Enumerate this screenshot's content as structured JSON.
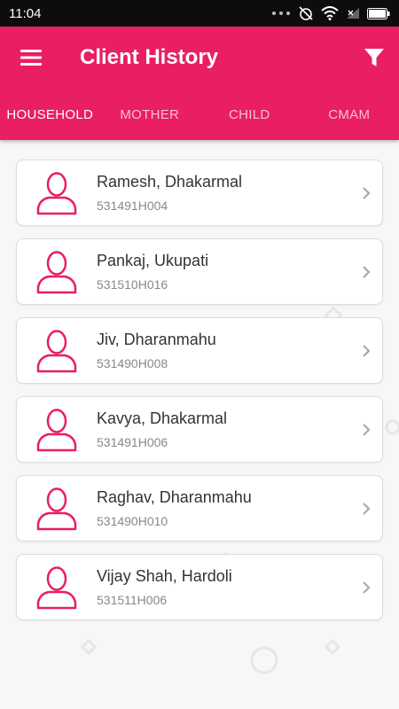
{
  "status_bar": {
    "time": "11:04"
  },
  "appbar": {
    "title": "Client History"
  },
  "tabs": [
    {
      "label": "HOUSEHOLD",
      "active": true
    },
    {
      "label": "MOTHER",
      "active": false
    },
    {
      "label": "CHILD",
      "active": false
    },
    {
      "label": "CMAM",
      "active": false
    }
  ],
  "clients": [
    {
      "name": "Ramesh, Dhakarmal",
      "id": "531491H004"
    },
    {
      "name": "Pankaj, Ukupati",
      "id": "531510H016"
    },
    {
      "name": "Jiv, Dharanmahu",
      "id": "531490H008"
    },
    {
      "name": "Kavya, Dhakarmal",
      "id": "531491H006"
    },
    {
      "name": "Raghav, Dharanmahu",
      "id": "531490H010"
    },
    {
      "name": "Vijay Shah, Hardoli",
      "id": "531511H006"
    }
  ],
  "colors": {
    "primary": "#e91e63",
    "status_bar": "#0d0d0d",
    "background": "#f7f7f7"
  }
}
